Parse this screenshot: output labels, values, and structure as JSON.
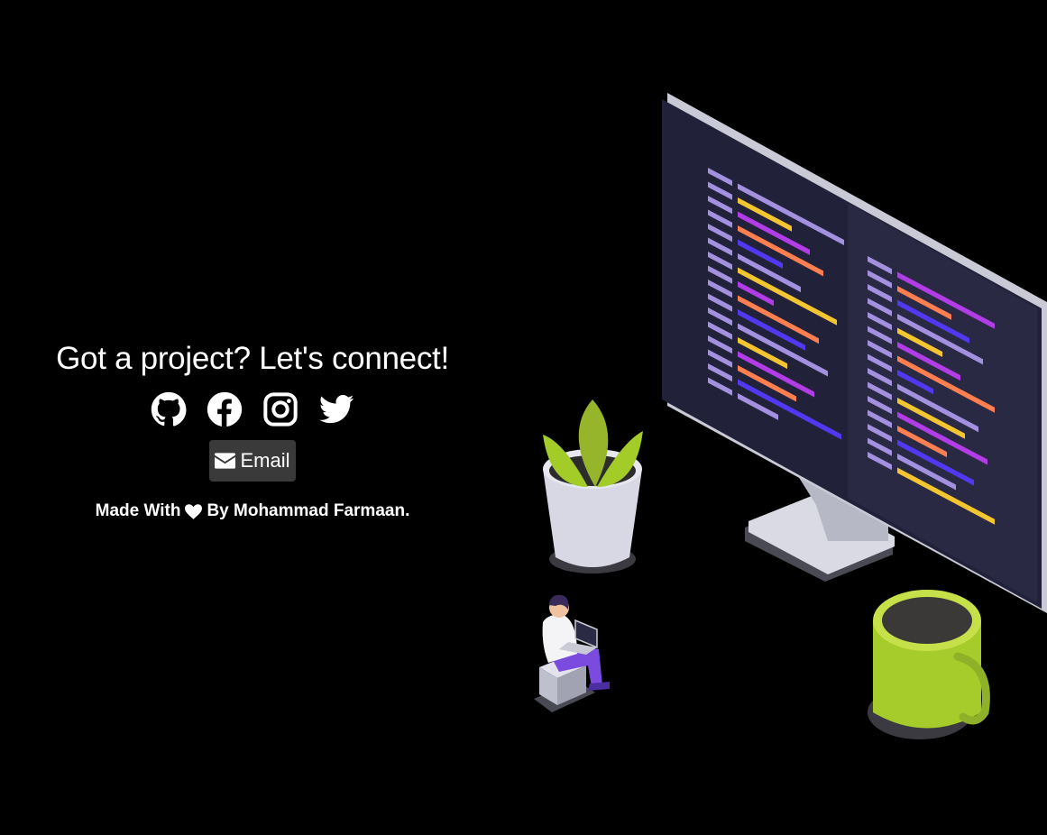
{
  "contact": {
    "headline": "Got a project? Let's connect!",
    "social": [
      {
        "name": "github",
        "icon": "github-icon"
      },
      {
        "name": "facebook",
        "icon": "facebook-icon"
      },
      {
        "name": "instagram",
        "icon": "instagram-icon"
      },
      {
        "name": "twitter",
        "icon": "twitter-icon"
      }
    ],
    "email_label": "Email",
    "credit_prefix": "Made With",
    "credit_suffix": "By Mohammad Farmaan."
  },
  "colors": {
    "background": "#000000",
    "text": "#ffffff",
    "button_bg": "#3a3a3a",
    "code_purple": "#b23ce6",
    "code_blue": "#5238f0",
    "code_yellow": "#f5c531",
    "code_orange": "#ff7f50",
    "code_lavender": "#a391e0",
    "plant_green": "#a3cc28",
    "mug_green": "#a6cc2b"
  }
}
